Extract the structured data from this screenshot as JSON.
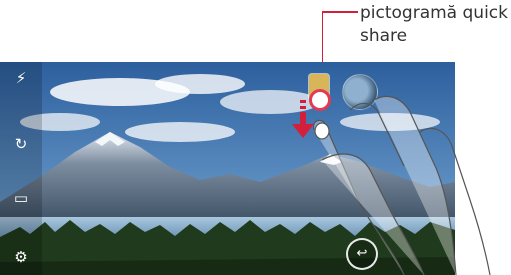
{
  "annotation": {
    "label": "pictogramă quick share"
  },
  "colors": {
    "callout": "#d21f3c",
    "arrow": "#d21f3c",
    "sky": "#3a78c2",
    "mountain": "#5d6f82",
    "snow": "#eef3f7",
    "forest": "#243a1f",
    "lake": "#8fb6d0"
  },
  "icons": {
    "flash": "lightning-icon",
    "switch_camera": "camera-switch-icon",
    "mode": "mode-icon",
    "settings": "gear-icon",
    "back": "back-icon",
    "gesture": "swipe-down-arrow-icon"
  }
}
